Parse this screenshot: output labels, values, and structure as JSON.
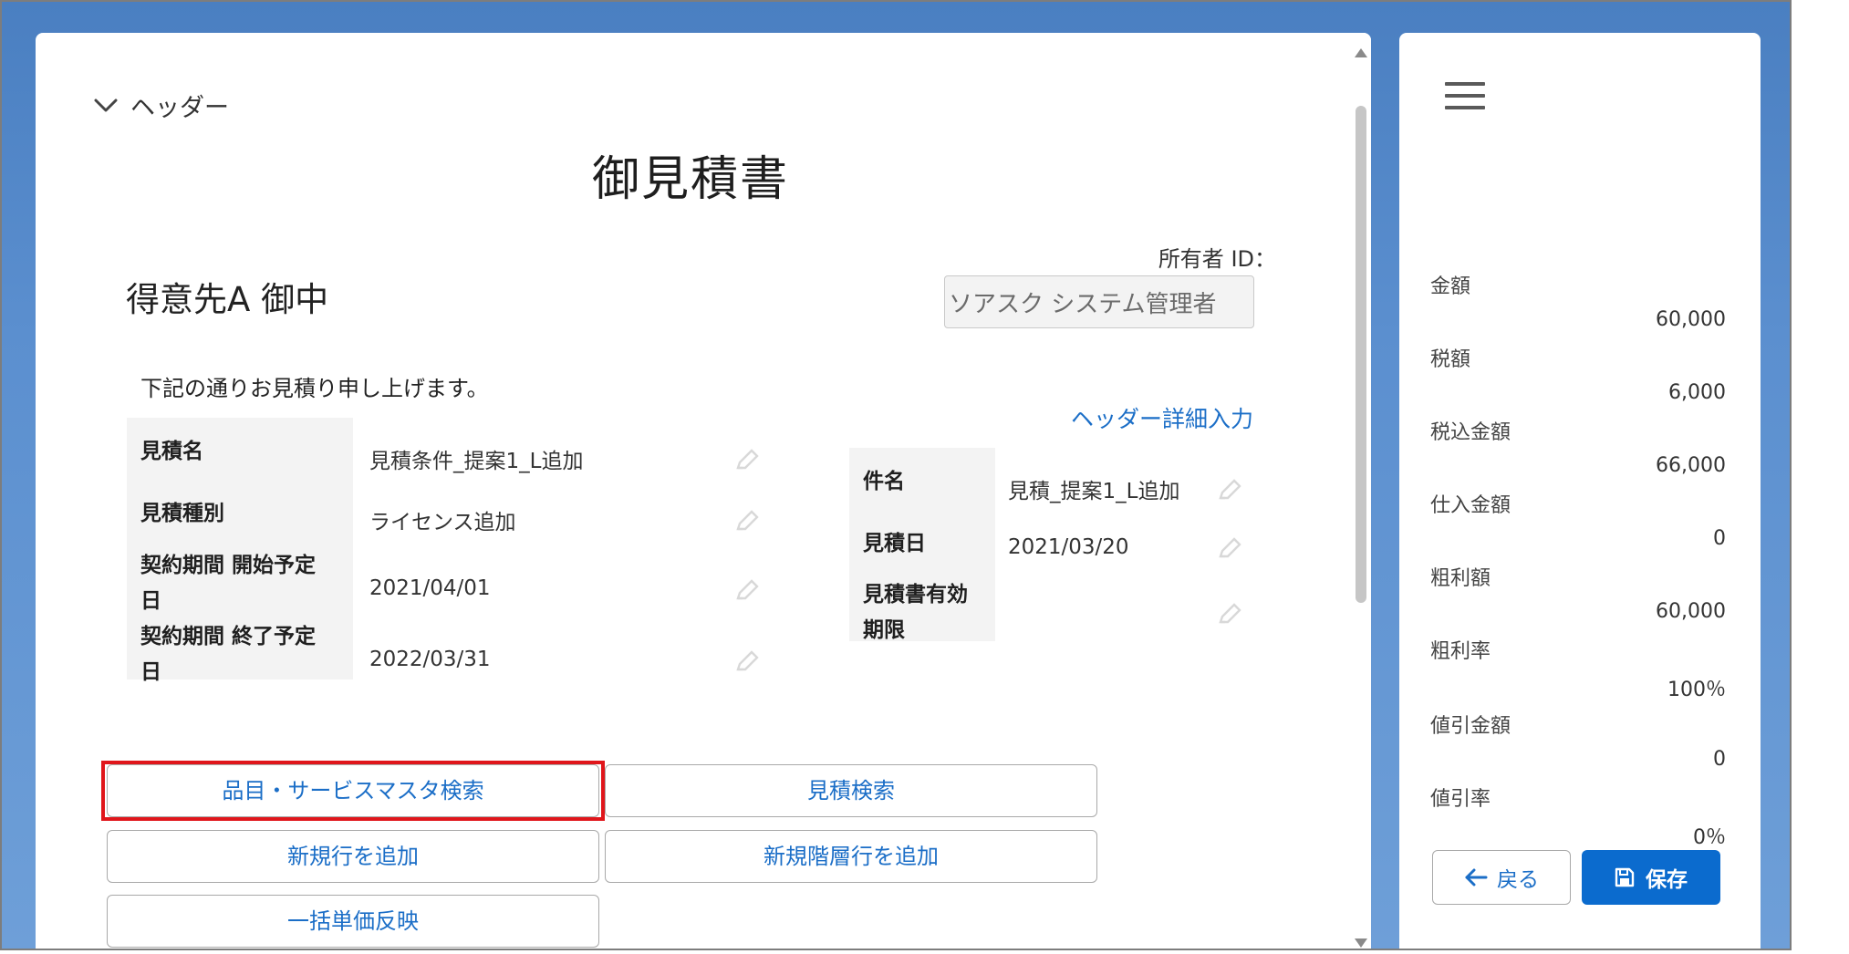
{
  "header": {
    "section_toggle_label": "ヘッダー",
    "document_title": "御見積書",
    "customer_name": "得意先A 御中",
    "owner_label": "所有者 ID：",
    "owner_value": "ソアスク システム管理者",
    "greeting": "下記の通りお見積り申し上げます。",
    "detail_link": "ヘッダー詳細入力"
  },
  "left_fields": [
    {
      "label": "見積名",
      "value": "見積条件_提案1_L追加"
    },
    {
      "label": "見積種別",
      "value": "ライセンス追加"
    },
    {
      "label_line1": "契約期間 開始予定",
      "label_line2": "日",
      "value": "2021/04/01"
    },
    {
      "label_line1": "契約期間 終了予定",
      "label_line2": "日",
      "value": "2022/03/31"
    }
  ],
  "right_fields": [
    {
      "label": "件名",
      "value": "見積_提案1_L追加"
    },
    {
      "label": "見積日",
      "value": "2021/03/20"
    },
    {
      "label_line1": "見積書有効",
      "label_line2": "期限",
      "value": ""
    }
  ],
  "actions": {
    "product_search": "品目・サービスマスタ検索",
    "estimate_search": "見積検索",
    "add_row": "新規行を追加",
    "add_hierarchy_row": "新規階層行を追加",
    "bulk_price": "一括単価反映"
  },
  "summary": [
    {
      "label": "金額",
      "value": "60,000"
    },
    {
      "label": "税額",
      "value": "6,000"
    },
    {
      "label": "税込金額",
      "value": "66,000"
    },
    {
      "label": "仕入金額",
      "value": "0"
    },
    {
      "label": "粗利額",
      "value": "60,000"
    },
    {
      "label": "粗利率",
      "value": "100％"
    },
    {
      "label": "値引金額",
      "value": "0"
    },
    {
      "label": "値引率",
      "value": "0％"
    }
  ],
  "footer": {
    "back_label": "戻る",
    "save_label": "保存"
  },
  "colors": {
    "accent": "#1b6ec7",
    "primary_button": "#0b6bce",
    "highlight": "#e0161b",
    "background_blue": "#4a7fc1"
  },
  "icons": {
    "toggle": "chevron-down-icon",
    "edit": "pencil-icon",
    "menu": "hamburger-menu-icon",
    "back": "arrow-left-icon",
    "save": "save-disk-icon"
  }
}
